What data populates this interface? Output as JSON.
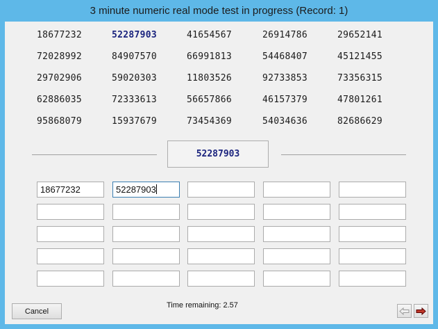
{
  "window": {
    "title": "3 minute numeric real mode test in progress (Record: 1)"
  },
  "numbers": [
    [
      "18677232",
      "52287903",
      "41654567",
      "26914786",
      "29652141"
    ],
    [
      "72028992",
      "84907570",
      "66991813",
      "54468407",
      "45121455"
    ],
    [
      "29702906",
      "59020303",
      "11803526",
      "92733853",
      "73356315"
    ],
    [
      "62886035",
      "72333613",
      "56657866",
      "46157379",
      "47801261"
    ],
    [
      "95868079",
      "15937679",
      "73454369",
      "54034636",
      "82686629"
    ]
  ],
  "highlighted": {
    "row": 0,
    "col": 1
  },
  "target_number": "52287903",
  "entries": [
    [
      "18677232",
      "52287903",
      "",
      "",
      ""
    ],
    [
      "",
      "",
      "",
      "",
      ""
    ],
    [
      "",
      "",
      "",
      "",
      ""
    ],
    [
      "",
      "",
      "",
      "",
      ""
    ],
    [
      "",
      "",
      "",
      "",
      ""
    ]
  ],
  "active_entry": {
    "row": 0,
    "col": 1
  },
  "footer": {
    "cancel_label": "Cancel",
    "time_remaining": "Time remaining: 2.57"
  },
  "icons": {
    "back": "arrow-left-icon",
    "forward": "arrow-right-icon"
  },
  "colors": {
    "titlebar": "#5eb8e8",
    "highlight": "#1a237e",
    "forward_arrow": "#c0392b"
  }
}
